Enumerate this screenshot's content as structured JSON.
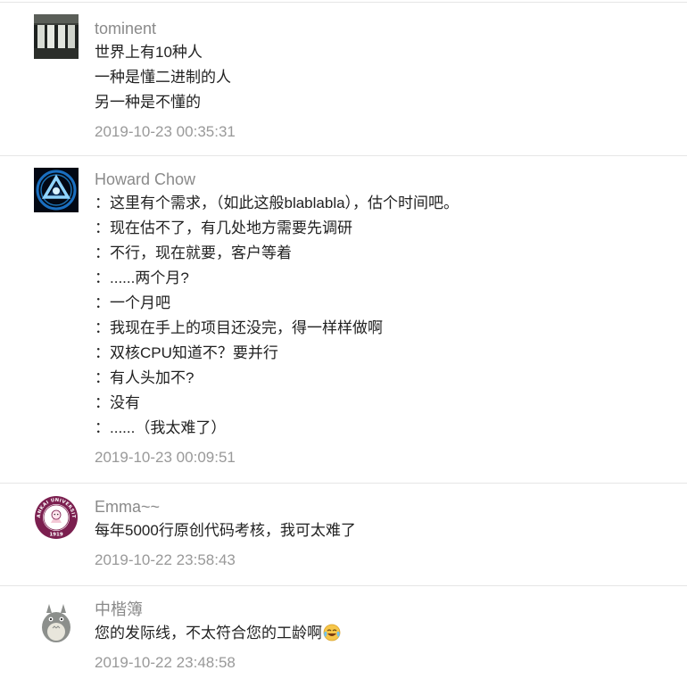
{
  "comments": [
    {
      "author": "tominent",
      "avatar": "photo-avatar-doors",
      "lines": [
        "世界上有10种人",
        "一种是懂二进制的人",
        "另一种是不懂的"
      ],
      "timestamp": "2019-10-23 00:35:31"
    },
    {
      "author": "Howard Chow",
      "avatar": "arc-reactor-avatar",
      "lines": [
        "：这里有个需求，（如此这般blablabla），估个时间吧。",
        "：现在估不了，有几处地方需要先调研",
        "：不行，现在就要，客户等着",
        "：......两个月?",
        "：一个月吧",
        "：我现在手上的项目还没完，得一样样做啊",
        "：双核CPU知道不？要并行",
        "：有人头加不?",
        "：没有",
        "：......（我太难了）"
      ],
      "timestamp": "2019-10-23 00:09:51"
    },
    {
      "author": "Emma~~",
      "avatar": "university-seal-avatar",
      "seal_text": "NANKAI UNIVERSITY",
      "seal_year": "1919",
      "lines": [
        "每年5000行原创代码考核，我可太难了"
      ],
      "timestamp": "2019-10-22 23:58:43"
    },
    {
      "author": "中楷簿",
      "avatar": "totoro-avatar",
      "lines": [
        "您的发际线，不太符合您的工龄啊"
      ],
      "emoji": "laughing-crying-emoji",
      "timestamp": "2019-10-22 23:48:58"
    }
  ]
}
